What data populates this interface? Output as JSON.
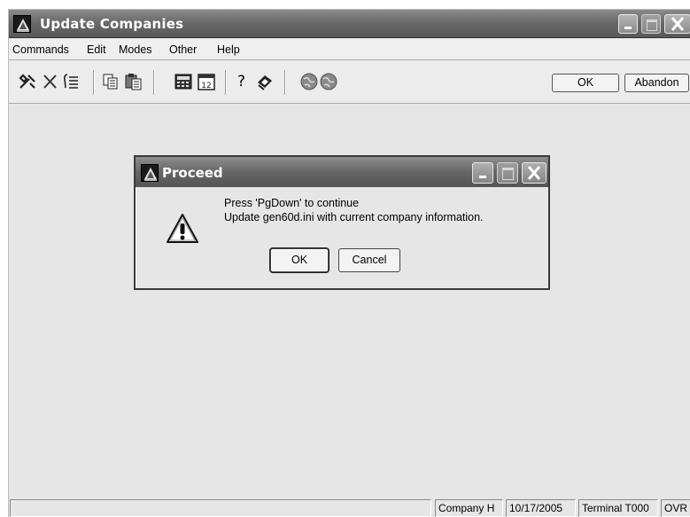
{
  "window": {
    "title": "Update Companies"
  },
  "menubar": {
    "items": [
      "Commands",
      "Edit",
      "Modes",
      "Other",
      "Help"
    ]
  },
  "toolbar": {
    "ok_label": "OK",
    "abandon_label": "Abandon",
    "help_glyph": "?",
    "icons": [
      "tools-icon",
      "delete-icon",
      "list-icon",
      "copy-icon",
      "paste-icon",
      "calculator-icon",
      "calendar-icon",
      "help-icon",
      "bookmark-icon",
      "globe-back-icon",
      "globe-forward-icon"
    ]
  },
  "dialog": {
    "title": "Proceed",
    "message_line1": "Press 'PgDown' to continue",
    "message_line2": "Update gen60d.ini with current company information.",
    "ok_label": "OK",
    "cancel_label": "Cancel",
    "icon": "warning-icon"
  },
  "statusbar": {
    "company": "Company H",
    "date": "10/17/2005",
    "terminal": "Terminal T000",
    "mode": "OVR"
  }
}
